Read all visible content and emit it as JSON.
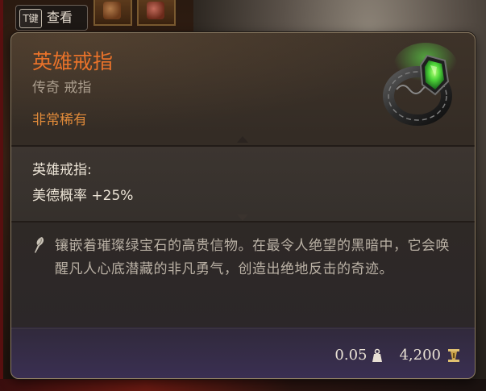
{
  "hotkey": {
    "key_label": "T键",
    "action_label": "查看"
  },
  "item": {
    "name": "英雄戒指",
    "type": "传奇 戒指",
    "rarity": "非常稀有",
    "passive_title": "英雄戒指:",
    "passive_effect": "美德概率  +25%",
    "description": "镶嵌着璀璨绿宝石的高贵信物。在最令人绝望的黑暗中，它会唤醒凡人心底潜藏的非凡勇气，创造出绝地反击的奇迹。",
    "weight": "0.05",
    "value": "4,200",
    "icon": "emerald-ring-icon"
  },
  "colors": {
    "title": "#e8722a",
    "rarity": "#e08a3a",
    "gem": "#4fd63a"
  }
}
